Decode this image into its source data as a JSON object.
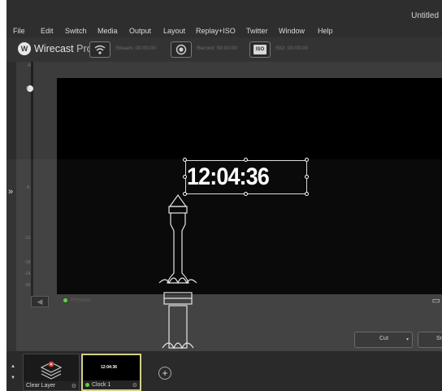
{
  "window": {
    "title": "Untitled"
  },
  "menu": [
    "File",
    "Edit",
    "Switch",
    "Media",
    "Output",
    "Layout",
    "Replay+ISO",
    "Twitter",
    "Window",
    "Help"
  ],
  "toolbar": {
    "brand": "Wirecast",
    "edition": "Pro",
    "stream_label": "Stream: 00:00:00",
    "record_label": "Record: 00:00:00",
    "iso_badge": "ISO",
    "iso_label": "ISO: 00:00:00"
  },
  "audio": {
    "scale": [
      "40",
      "0",
      "-6",
      "-12",
      "-18",
      "-24",
      "-36"
    ]
  },
  "preview": {
    "label": "Preview",
    "clock_text": "12:04:36"
  },
  "transition": {
    "selected": "Cut",
    "smooth_label": "Sm"
  },
  "shots": [
    {
      "caption": "Clear Layer",
      "thumb": "clear-layer-icon"
    },
    {
      "caption": "Clock 1",
      "thumb_text": "12:04:36",
      "live": true
    }
  ],
  "colors": {
    "accent": "#d4d18a",
    "live_dot": "#5bd63a",
    "background": "#3c3c3c"
  }
}
